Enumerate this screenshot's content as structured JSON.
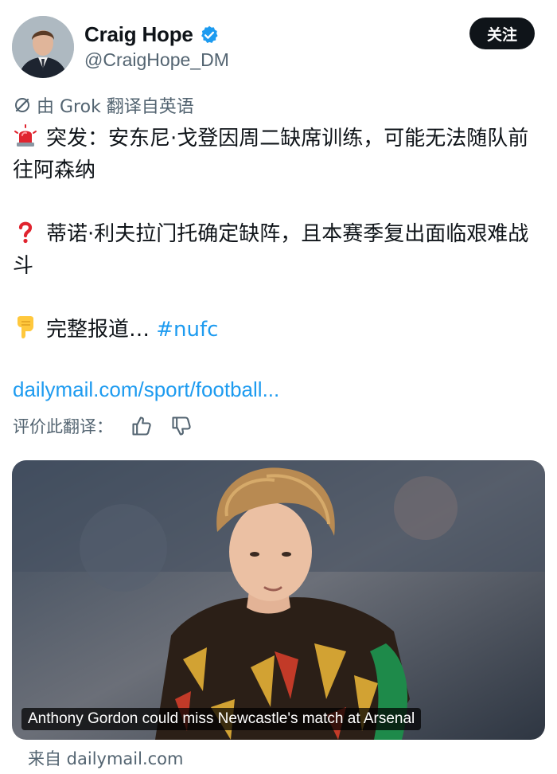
{
  "author": {
    "name": "Craig Hope",
    "handle": "@CraigHope_DM",
    "verified": true,
    "avatar_icon": "profile-photo"
  },
  "follow_button": {
    "label": "关注"
  },
  "translation_notice": "由 Grok 翻译自英语",
  "tweet": {
    "line1_emoji": "rotating-light",
    "line1_text": "突发：安东尼·戈登因周二缺席训练，可能无法随队前往阿森纳",
    "line2_emoji": "red-question-mark",
    "line2_text": "蒂诺·利夫拉门托确定缺阵，且本赛季复出面临艰难战斗",
    "line3_emoji": "backhand-index-pointing-down",
    "line3_text": "完整报道… ",
    "hashtag": "#nufc"
  },
  "link": "dailymail.com/sport/football...",
  "rate_translation_label": "评价此翻译：",
  "card": {
    "caption": "Anthony Gordon could miss Newcastle's match at Arsenal"
  },
  "source_label": "来自 dailymail.com",
  "colors": {
    "accent": "#1d9bf0",
    "text": "#0f1419",
    "muted": "#536471"
  }
}
